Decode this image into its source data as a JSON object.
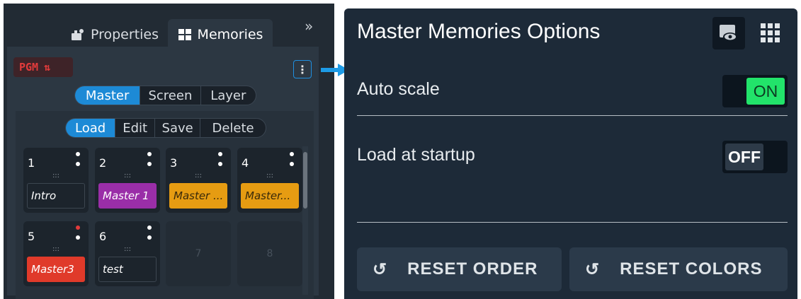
{
  "left": {
    "tabs": {
      "properties": "Properties",
      "memories": "Memories"
    },
    "collapse_glyph": "»",
    "pgm_label": "PGM",
    "pgm_glyph": "⇅",
    "menu_glyph": "⋮",
    "scope_tabs": [
      "Master",
      "Screen",
      "Layer"
    ],
    "scope_active": "Master",
    "action_tabs": [
      "Load",
      "Edit",
      "Save",
      "Delete"
    ],
    "action_active": "Load",
    "grip": ":::",
    "memories": [
      {
        "num": "1",
        "label": "Intro",
        "color": "#1c242c",
        "label_color": "#ffffff",
        "dot_active": false
      },
      {
        "num": "2",
        "label": "Master 1",
        "color": "#9a2ea8",
        "label_color": "#ffffff",
        "dot_active": false
      },
      {
        "num": "3",
        "label": "Master ...",
        "color": "#e69c12",
        "label_color": "#3a2a0a",
        "dot_active": false
      },
      {
        "num": "4",
        "label": "Master...",
        "color": "#e69c12",
        "label_color": "#3a2a0a",
        "dot_active": false
      },
      {
        "num": "5",
        "label": "Master3",
        "color": "#e03a2a",
        "label_color": "#ffffff",
        "dot_active": true
      },
      {
        "num": "6",
        "label": "test",
        "color": "#1c242c",
        "label_color": "#ffffff",
        "dot_active": false
      }
    ],
    "empty_slots": [
      "7",
      "8"
    ]
  },
  "options": {
    "title": "Master Memories Options",
    "auto_scale": {
      "label": "Auto scale",
      "state": "ON"
    },
    "load_at_startup": {
      "label": "Load at startup",
      "state": "OFF"
    },
    "reset_order": "RESET ORDER",
    "reset_colors": "RESET COLORS",
    "reset_glyph": "↺"
  },
  "colors": {
    "accent_blue": "#1d8ad6",
    "toggle_on": "#22e36a",
    "pgm_red": "#e23b3b"
  },
  "icons": [
    "properties-icon",
    "memories-icon",
    "collapse-icon",
    "pgm-swap-icon",
    "kebab-menu-icon",
    "eye-icon",
    "grid-icon",
    "reset-icon",
    "arrow-icon"
  ]
}
